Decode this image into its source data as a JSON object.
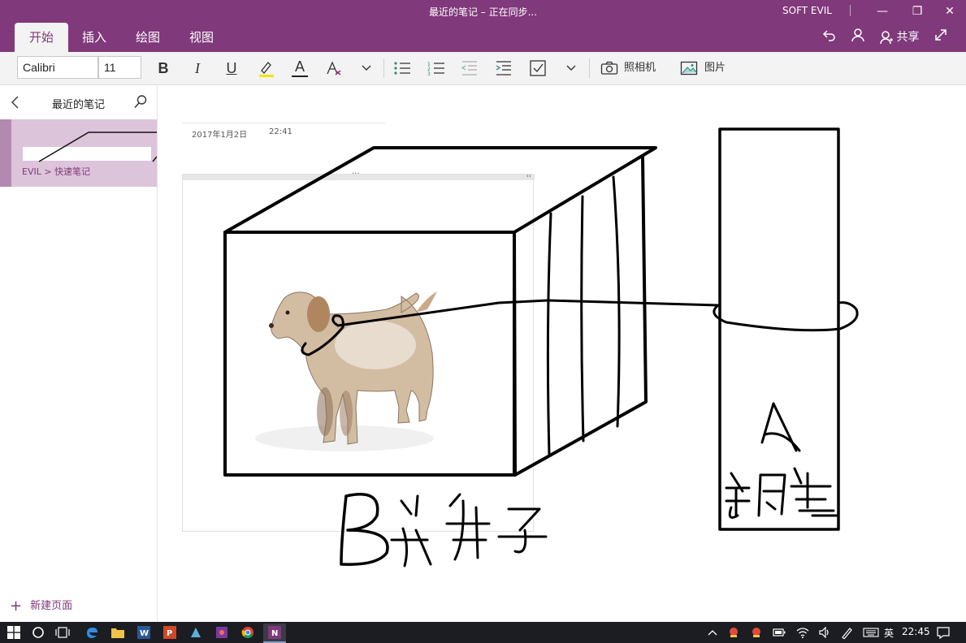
{
  "window": {
    "title": "最近的笔记 – 正在同步...",
    "user": "SOFT EVIL",
    "minimize": "—",
    "restore": "❐",
    "close": "✕"
  },
  "tabs": [
    {
      "label": "开始"
    },
    {
      "label": "插入"
    },
    {
      "label": "绘图"
    },
    {
      "label": "视图"
    }
  ],
  "header_actions": {
    "share_label": "共享"
  },
  "ribbon": {
    "font_name": "Calibri",
    "font_size": "11",
    "bold": "B",
    "italic": "I",
    "underline": "U",
    "font_color": "A",
    "camera_label": "照相机",
    "picture_label": "图片"
  },
  "sidebar": {
    "title": "最近的笔记",
    "item": {
      "breadcrumb": "EVIL > 快速笔记"
    },
    "new_page": "新建页面"
  },
  "page": {
    "date": "2017年1月2日",
    "time": "22:41"
  },
  "taskbar": {
    "ime": "英",
    "clock": "22:45"
  },
  "colors": {
    "accent": "#80397b",
    "selection": "#dcc4da",
    "taskbar": "#1c1d22"
  }
}
